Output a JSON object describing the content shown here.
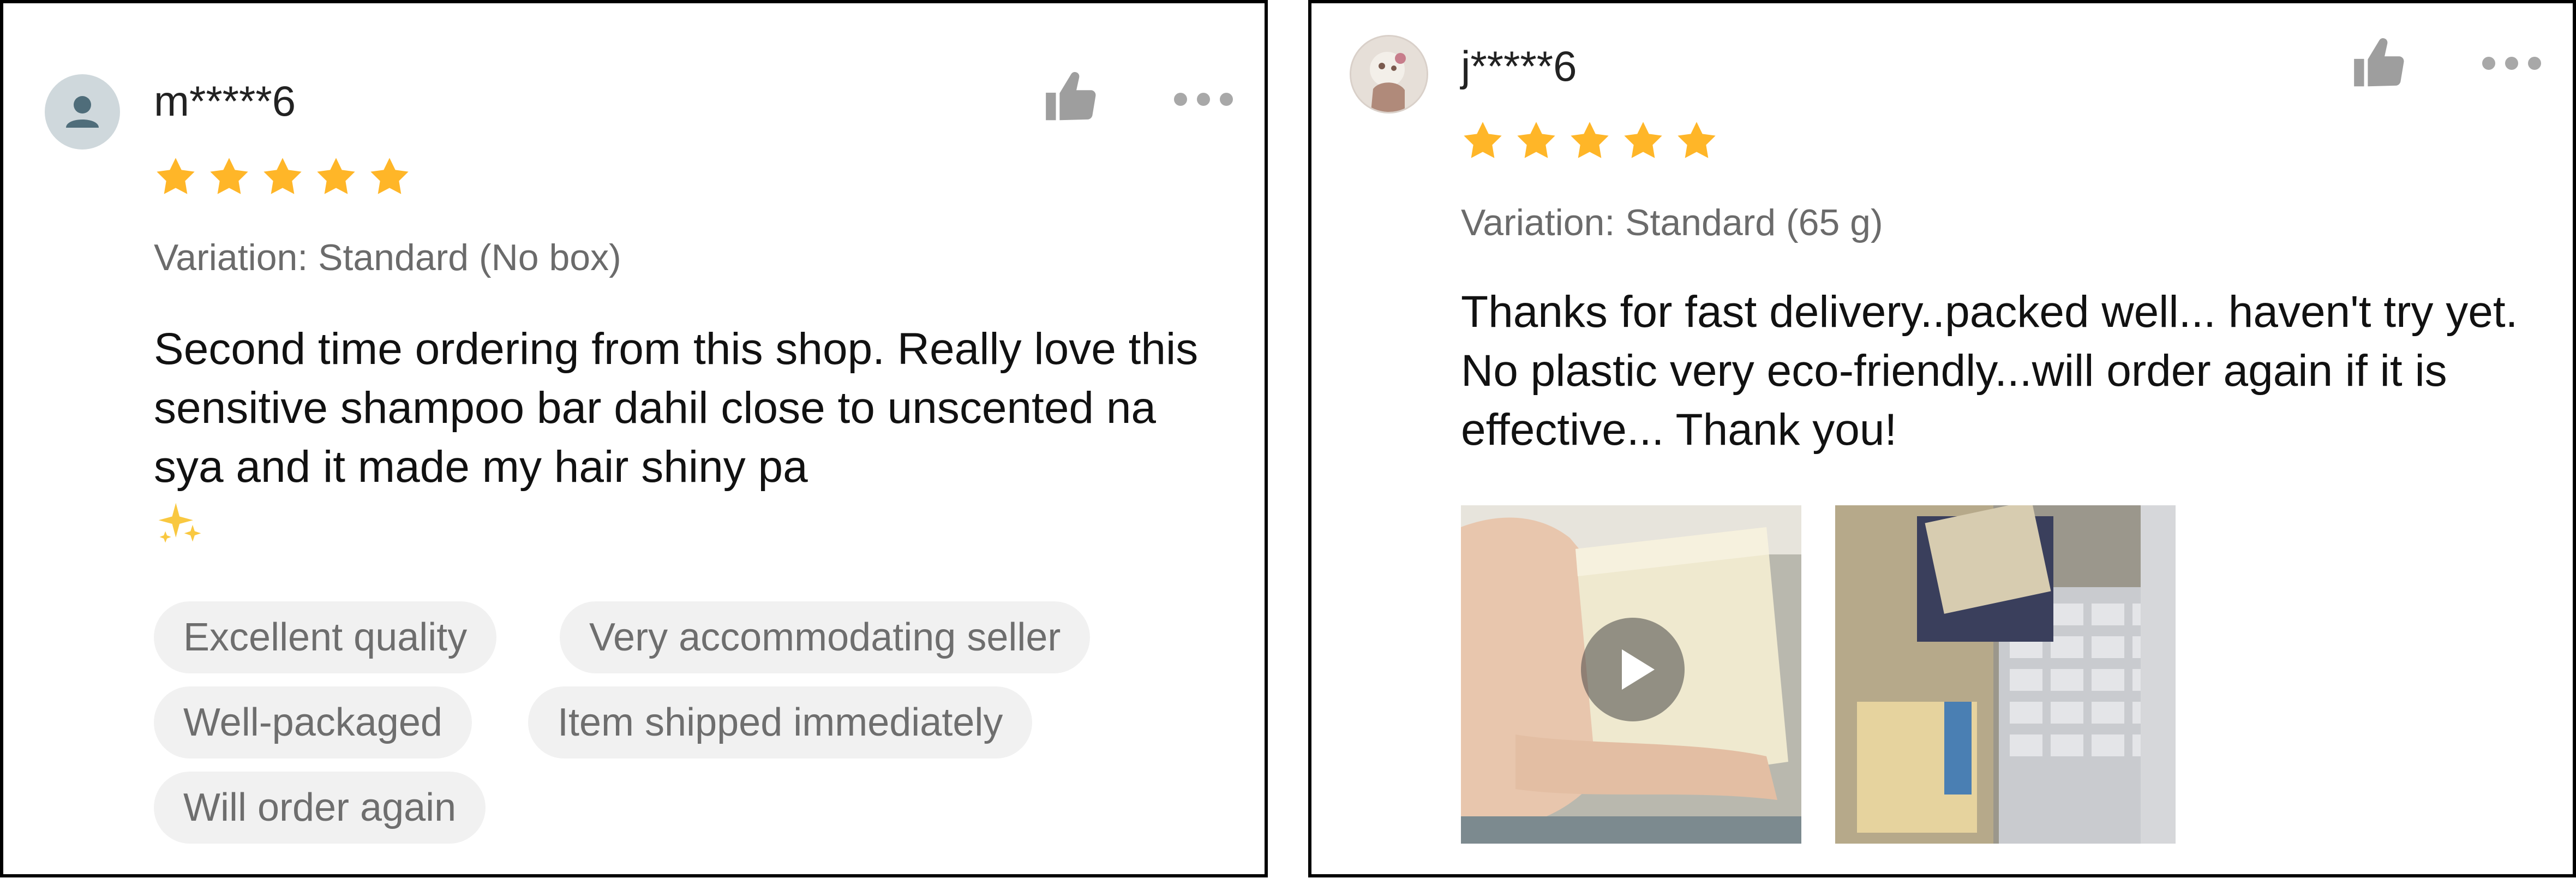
{
  "reviews": [
    {
      "username": "m*****6",
      "rating": 5,
      "variation": "Variation: Standard (No box)",
      "text": "Second time ordering from this shop. Really love this sensitive shampoo bar dahil close to unscented na sya and it made my hair shiny pa",
      "tags": [
        "Excellent quality",
        "Very accommodating seller",
        "Well-packaged",
        "Item shipped immediately",
        "Will order again"
      ],
      "avatar_icon": "default-user-icon",
      "colors": {
        "star": "#FFB628",
        "tag_bg": "#F1F1F1",
        "muted_text": "#6B6B6B"
      }
    },
    {
      "username": "j*****6",
      "rating": 5,
      "variation": "Variation: Standard (65 g)",
      "text": "Thanks for fast delivery..packed well... haven't try yet. No plastic very eco-friendly...will order again if it is effective... Thank you!",
      "media": [
        {
          "kind": "video",
          "icon": "play-icon"
        },
        {
          "kind": "image"
        }
      ]
    }
  ]
}
